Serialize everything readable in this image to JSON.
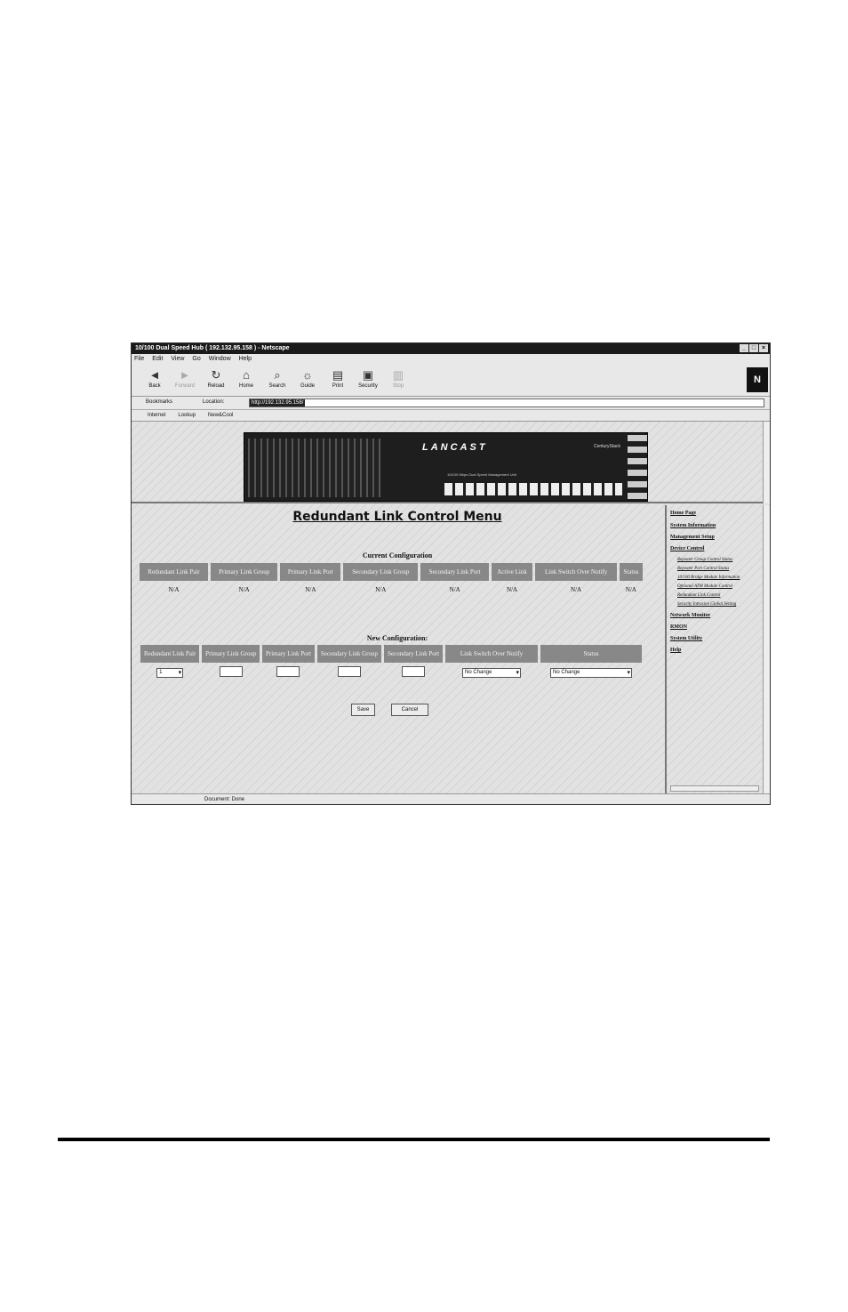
{
  "window": {
    "title": "10/100 Dual Speed Hub ( 192.132.95.158 ) - Netscape",
    "controls": [
      "_",
      "□",
      "×"
    ]
  },
  "menu": [
    "File",
    "Edit",
    "View",
    "Go",
    "Window",
    "Help"
  ],
  "toolbar": [
    {
      "label": "Back",
      "icon": "back-arrow-icon",
      "glyph": "◄"
    },
    {
      "label": "Forward",
      "icon": "forward-arrow-icon",
      "glyph": "►",
      "disabled": true
    },
    {
      "label": "Reload",
      "icon": "reload-icon",
      "glyph": "↻"
    },
    {
      "label": "Home",
      "icon": "home-icon",
      "glyph": "⌂"
    },
    {
      "label": "Search",
      "icon": "search-icon",
      "glyph": "⌕"
    },
    {
      "label": "Guide",
      "icon": "guide-icon",
      "glyph": "☼"
    },
    {
      "label": "Print",
      "icon": "print-icon",
      "glyph": "▤"
    },
    {
      "label": "Security",
      "icon": "security-lock-icon",
      "glyph": "▣"
    },
    {
      "label": "Stop",
      "icon": "stop-icon",
      "glyph": "▥",
      "disabled": true
    }
  ],
  "browser_logo": "N",
  "location": {
    "bookmarks_label": "Bookmarks",
    "location_label": "Location:",
    "url": "http://192.132.95.158/"
  },
  "linkbar": [
    "Internet",
    "Lookup",
    "New&Cool"
  ],
  "device": {
    "brand": "LANCAST",
    "model": "CenturyStack",
    "ports_caption": "10/100 Mbps Dual Speed Management Unit"
  },
  "page": {
    "title": "Redundant Link Control Menu",
    "current": {
      "heading": "Current Configuration",
      "columns": [
        "Redundant Link Pair",
        "Primary Link Group",
        "Primary Link Port",
        "Secondary Link Group",
        "Secondary Link Port",
        "Active Link",
        "Link Switch Over Notify",
        "Status"
      ],
      "values": [
        "N/A",
        "N/A",
        "N/A",
        "N/A",
        "N/A",
        "N/A",
        "N/A",
        "N/A"
      ]
    },
    "new": {
      "heading": "New Configuration:",
      "columns": [
        "Redundant Link Pair",
        "Primary Link Group",
        "Primary Link Port",
        "Secondary Link Group",
        "Secondary Link Port",
        "Link Switch Over Notify",
        "Status"
      ],
      "pair_value": "1",
      "notify_value": "No Change",
      "status_value": "No Change"
    },
    "save_label": "Save",
    "cancel_label": "Cancel"
  },
  "nav": {
    "items": [
      "Home Page",
      "System Information",
      "Management Setup",
      "Device Control"
    ],
    "subitems": [
      "Repeater Group Control Status",
      "Repeater Port Control Status",
      "10/100 Bridge Module Information",
      "Optional ATM Module Control",
      "Redundant Link Control",
      "Security Intrusion Global Setting"
    ],
    "items2": [
      "Network Monitor",
      "RMON",
      "System Utility",
      "Help"
    ]
  },
  "status": {
    "text": "Document: Done"
  }
}
